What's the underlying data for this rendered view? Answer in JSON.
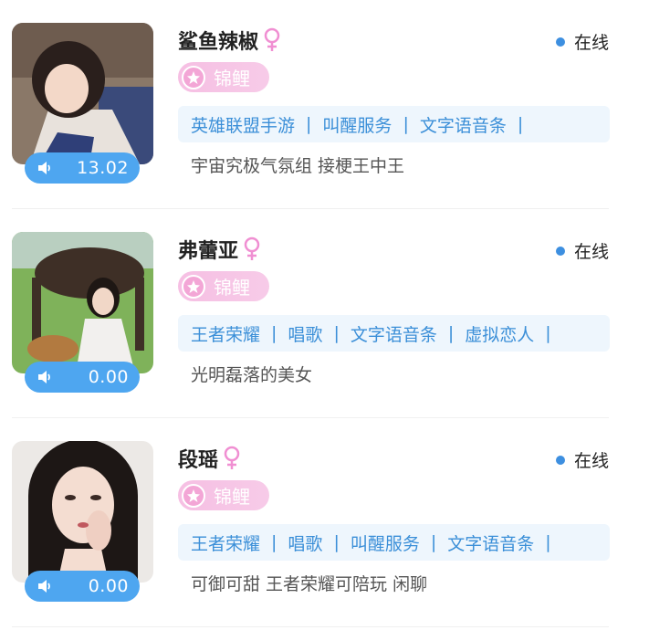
{
  "users": [
    {
      "name": "鲨鱼辣椒",
      "status": "在线",
      "badge": "锦鲤",
      "tags": [
        "英雄联盟手游",
        "叫醒服务",
        "文字语音条"
      ],
      "bio": "宇宙究极气氛组 接梗王中王",
      "voice_duration": "13.02"
    },
    {
      "name": "弗蕾亚",
      "status": "在线",
      "badge": "锦鲤",
      "tags": [
        "王者荣耀",
        "唱歌",
        "文字语音条",
        "虚拟恋人"
      ],
      "bio": "光明磊落的美女",
      "voice_duration": "0.00"
    },
    {
      "name": "段瑶",
      "status": "在线",
      "badge": "锦鲤",
      "tags": [
        "王者荣耀",
        "唱歌",
        "叫醒服务",
        "文字语音条"
      ],
      "bio": "可御可甜 王者荣耀可陪玩 闲聊",
      "voice_duration": "0.00"
    }
  ],
  "colors": {
    "voice_pill": "#4ea6f0",
    "online_dot": "#3d8fe0",
    "badge_pink": "#f6bfe3",
    "tag_bg": "#eef6fd",
    "tag_text": "#3b8fd8",
    "female_icon": "#f08fd2"
  },
  "icons": {
    "voice": "speaker-icon",
    "gender": "female-icon",
    "badge": "star-icon"
  }
}
